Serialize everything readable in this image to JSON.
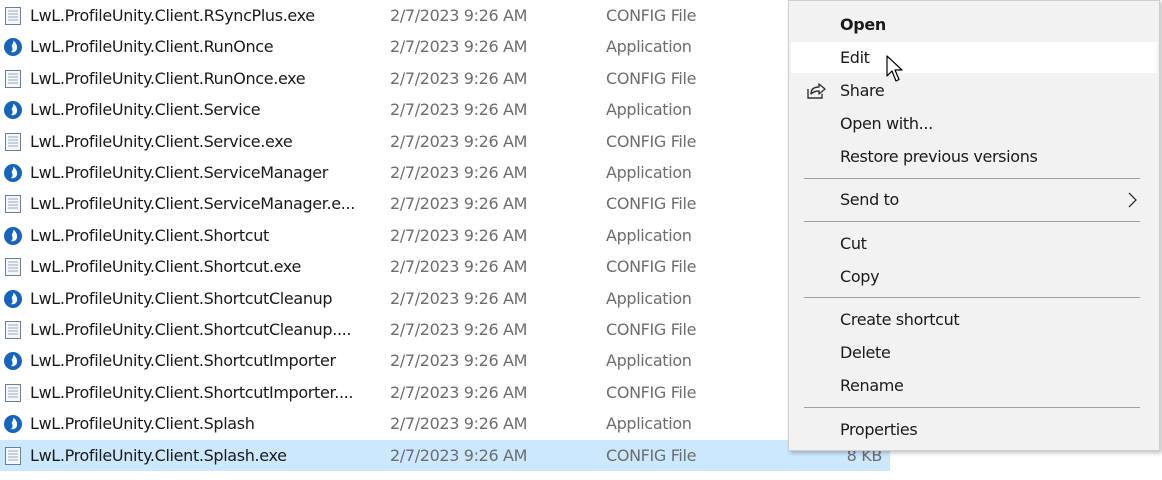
{
  "files": [
    {
      "name": "LwL.ProfileUnity.Client.RSyncPlus.exe",
      "date": "2/7/2023 9:26 AM",
      "type": "CONFIG File",
      "icon": "config-file-icon"
    },
    {
      "name": "LwL.ProfileUnity.Client.RunOnce",
      "date": "2/7/2023 9:26 AM",
      "type": "Application",
      "icon": "application-icon"
    },
    {
      "name": "LwL.ProfileUnity.Client.RunOnce.exe",
      "date": "2/7/2023 9:26 AM",
      "type": "CONFIG File",
      "icon": "config-file-icon"
    },
    {
      "name": "LwL.ProfileUnity.Client.Service",
      "date": "2/7/2023 9:26 AM",
      "type": "Application",
      "icon": "application-icon"
    },
    {
      "name": "LwL.ProfileUnity.Client.Service.exe",
      "date": "2/7/2023 9:26 AM",
      "type": "CONFIG File",
      "icon": "config-file-icon"
    },
    {
      "name": "LwL.ProfileUnity.Client.ServiceManager",
      "date": "2/7/2023 9:26 AM",
      "type": "Application",
      "icon": "application-icon"
    },
    {
      "name": "LwL.ProfileUnity.Client.ServiceManager.e...",
      "date": "2/7/2023 9:26 AM",
      "type": "CONFIG File",
      "icon": "config-file-icon"
    },
    {
      "name": "LwL.ProfileUnity.Client.Shortcut",
      "date": "2/7/2023 9:26 AM",
      "type": "Application",
      "icon": "application-icon"
    },
    {
      "name": "LwL.ProfileUnity.Client.Shortcut.exe",
      "date": "2/7/2023 9:26 AM",
      "type": "CONFIG File",
      "icon": "config-file-icon"
    },
    {
      "name": "LwL.ProfileUnity.Client.ShortcutCleanup",
      "date": "2/7/2023 9:26 AM",
      "type": "Application",
      "icon": "application-icon"
    },
    {
      "name": "LwL.ProfileUnity.Client.ShortcutCleanup....",
      "date": "2/7/2023 9:26 AM",
      "type": "CONFIG File",
      "icon": "config-file-icon"
    },
    {
      "name": "LwL.ProfileUnity.Client.ShortcutImporter",
      "date": "2/7/2023 9:26 AM",
      "type": "Application",
      "icon": "application-icon"
    },
    {
      "name": "LwL.ProfileUnity.Client.ShortcutImporter....",
      "date": "2/7/2023 9:26 AM",
      "type": "CONFIG File",
      "icon": "config-file-icon"
    },
    {
      "name": "LwL.ProfileUnity.Client.Splash",
      "date": "2/7/2023 9:26 AM",
      "type": "Application",
      "icon": "application-icon"
    },
    {
      "name": "LwL.ProfileUnity.Client.Splash.exe",
      "date": "2/7/2023 9:26 AM",
      "type": "CONFIG File",
      "size": "8 KB",
      "icon": "config-file-icon",
      "selected": true
    }
  ],
  "context_menu": {
    "items": {
      "open": "Open",
      "edit": "Edit",
      "share": "Share",
      "open_with": "Open with...",
      "restore": "Restore previous versions",
      "send_to": "Send to",
      "cut": "Cut",
      "copy": "Copy",
      "create_shortcut": "Create shortcut",
      "delete": "Delete",
      "rename": "Rename",
      "properties": "Properties"
    },
    "hovered": "edit"
  },
  "colors": {
    "selection": "#cce8ff",
    "menu_background": "#f2f2f2",
    "menu_hover": "#ffffff",
    "app_icon": "#1565c0"
  }
}
